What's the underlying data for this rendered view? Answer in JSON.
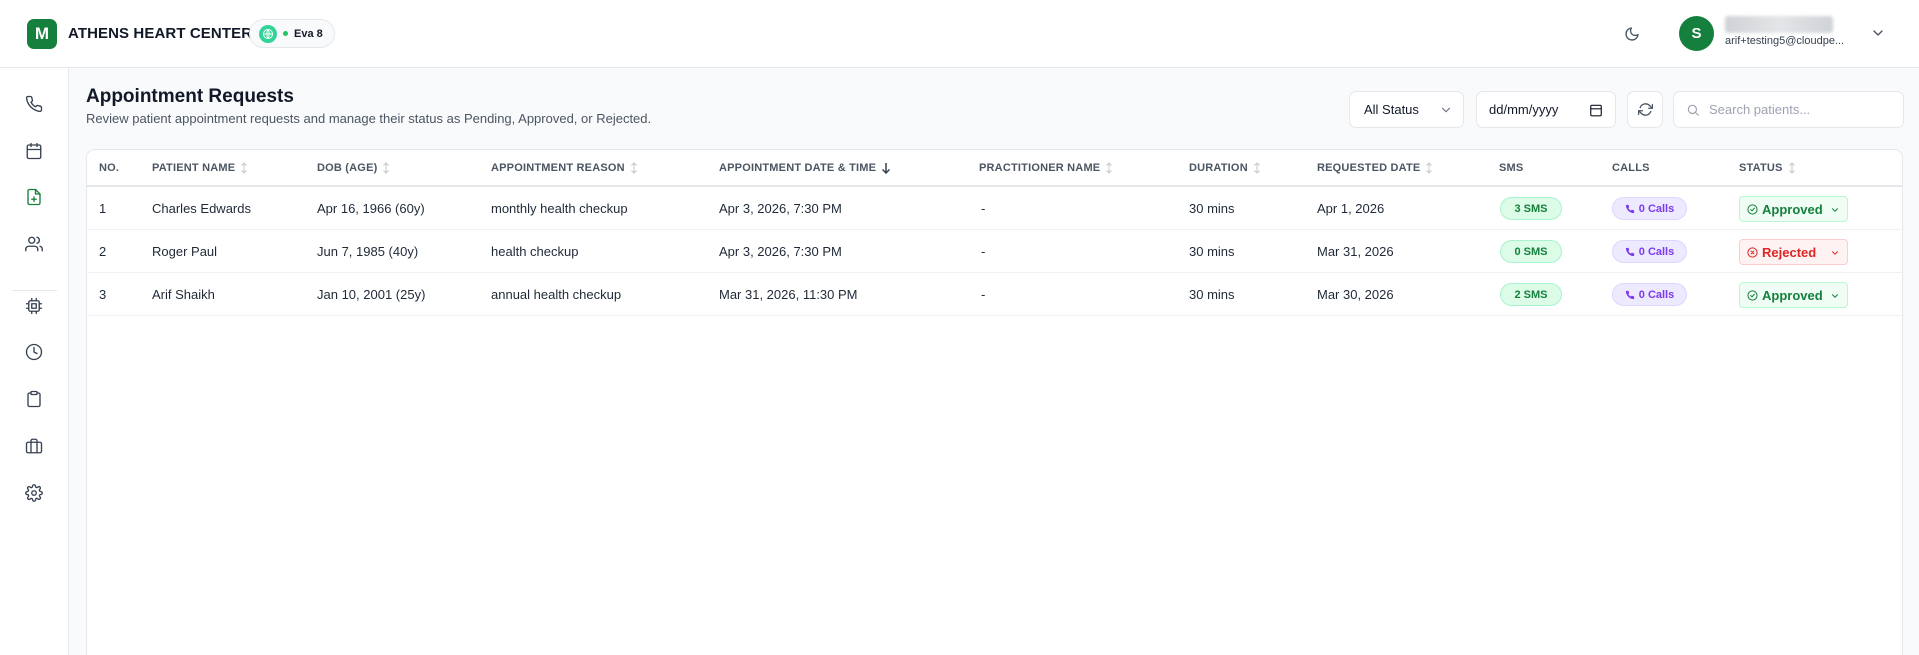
{
  "header": {
    "logo_letter": "M",
    "org_name": "ATHENS HEART CENTER",
    "agent_label": "Eva 8",
    "user_initial": "S",
    "user_email": "arif+testing5@cloudpe..."
  },
  "sidebar": {
    "items": [
      {
        "icon": "phone-icon",
        "active": false
      },
      {
        "icon": "calendar-icon",
        "active": false
      },
      {
        "icon": "file-plus-icon",
        "active": true
      },
      {
        "icon": "users-icon",
        "active": false
      },
      {
        "icon": "chip-icon",
        "active": false
      },
      {
        "icon": "clock-icon",
        "active": false
      },
      {
        "icon": "clipboard-icon",
        "active": false
      },
      {
        "icon": "briefcase-icon",
        "active": false
      },
      {
        "icon": "gear-icon",
        "active": false
      }
    ]
  },
  "page": {
    "title": "Appointment Requests",
    "subtitle": "Review patient appointment requests and manage their status as Pending, Approved, or Rejected."
  },
  "toolbar": {
    "status_filter": "All Status",
    "date_placeholder": "dd/mm/yyyy",
    "search_placeholder": "Search patients..."
  },
  "table": {
    "columns": {
      "no": "NO.",
      "patient_name": "PATIENT NAME",
      "dob": "DOB (AGE)",
      "reason": "APPOINTMENT REASON",
      "datetime": "APPOINTMENT DATE & TIME",
      "practitioner": "PRACTITIONER NAME",
      "duration": "DURATION",
      "requested": "REQUESTED DATE",
      "sms": "SMS",
      "calls": "CALLS",
      "status": "STATUS"
    },
    "rows": [
      {
        "no": "1",
        "patient_name": "Charles Edwards",
        "dob": "Apr 16, 1966 (60y)",
        "reason": "monthly health checkup",
        "datetime": "Apr 3, 2026, 7:30 PM",
        "practitioner": "-",
        "duration": "30 mins",
        "requested": "Apr 1, 2026",
        "sms": "3 SMS",
        "calls": "0 Calls",
        "status": "Approved"
      },
      {
        "no": "2",
        "patient_name": "Roger Paul",
        "dob": "Jun 7, 1985 (40y)",
        "reason": "health checkup",
        "datetime": "Apr 3, 2026, 7:30 PM",
        "practitioner": "-",
        "duration": "30 mins",
        "requested": "Mar 31, 2026",
        "sms": "0 SMS",
        "calls": "0 Calls",
        "status": "Rejected"
      },
      {
        "no": "3",
        "patient_name": "Arif Shaikh",
        "dob": "Jan 10, 2001 (25y)",
        "reason": "annual health checkup",
        "datetime": "Mar 31, 2026, 11:30 PM",
        "practitioner": "-",
        "duration": "30 mins",
        "requested": "Mar 30, 2026",
        "sms": "2 SMS",
        "calls": "0 Calls",
        "status": "Approved"
      }
    ]
  },
  "colors": {
    "brand": "#15803d",
    "approved": "#15803d",
    "rejected": "#dc2626",
    "calls": "#7c3aed"
  }
}
